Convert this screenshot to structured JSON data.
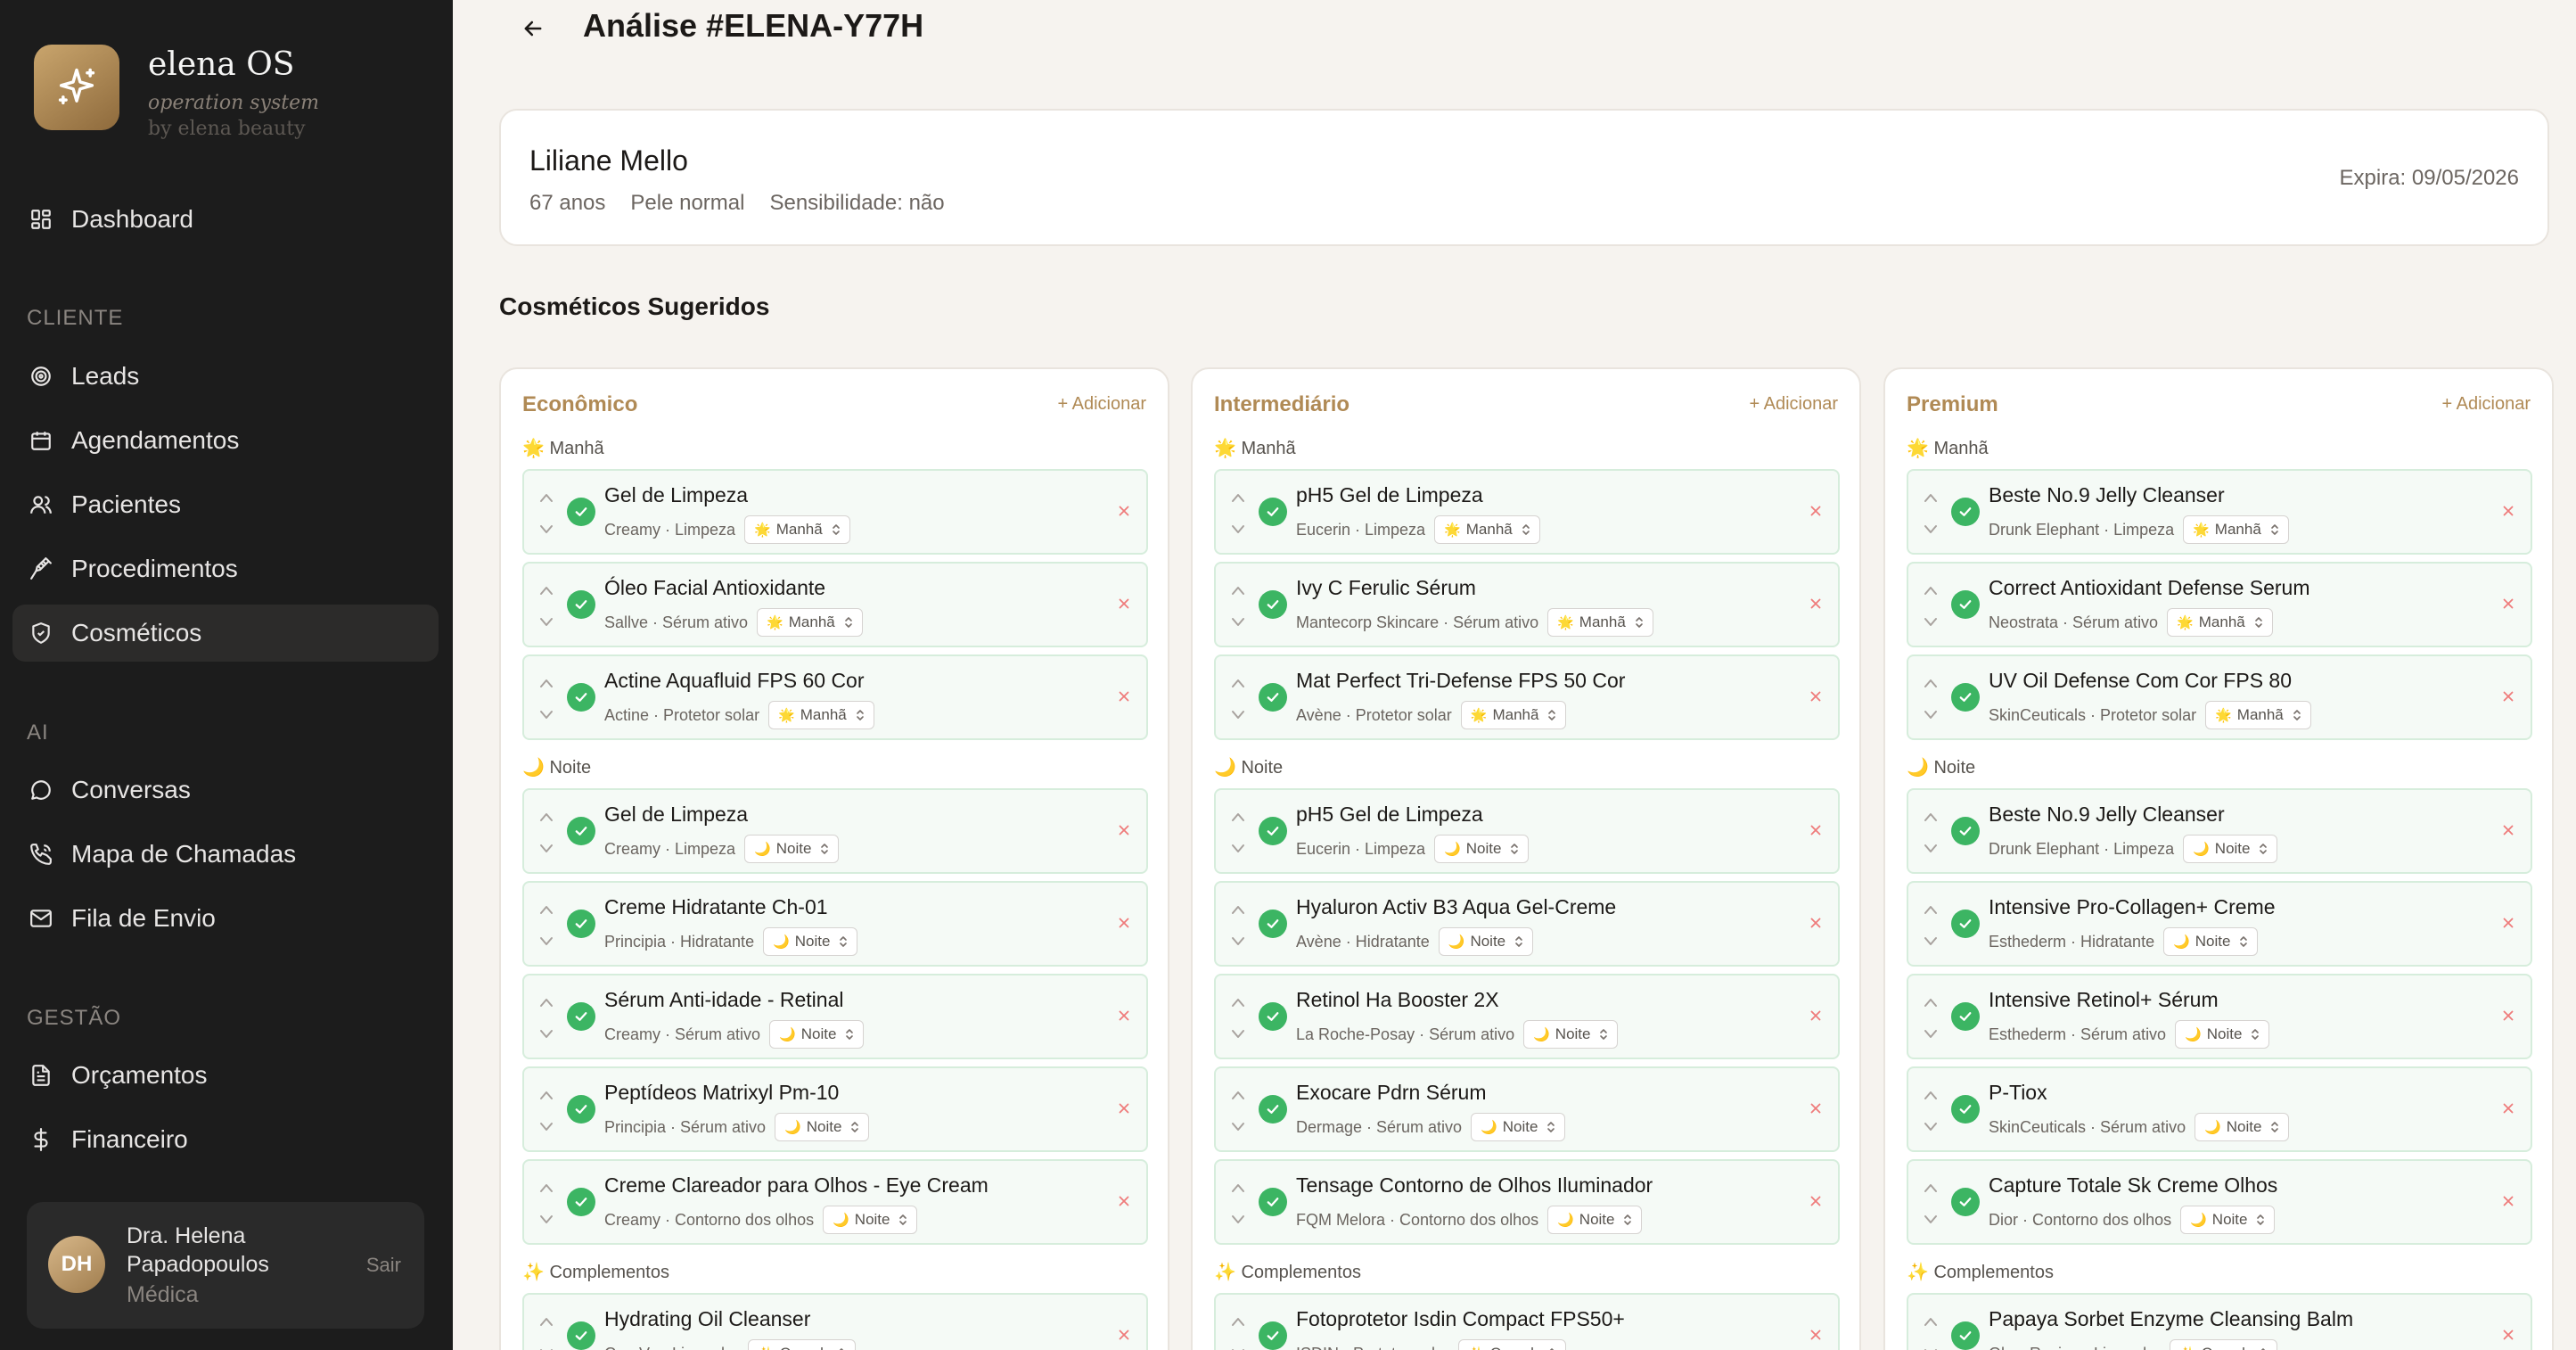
{
  "brand": {
    "name": "elena OS",
    "subtitle": "operation system",
    "byline": "by elena beauty",
    "logo_icon": "sparkles-icon"
  },
  "nav": {
    "dashboard": "Dashboard",
    "sections": {
      "cliente": "CLIENTE",
      "ai": "AI",
      "gestao": "GESTÃO"
    },
    "items": {
      "leads": "Leads",
      "agendamentos": "Agendamentos",
      "pacientes": "Pacientes",
      "procedimentos": "Procedimentos",
      "cosmeticos": "Cosméticos",
      "conversas": "Conversas",
      "mapa": "Mapa de Chamadas",
      "fila": "Fila de Envio",
      "orcamentos": "Orçamentos",
      "financeiro": "Financeiro"
    }
  },
  "user": {
    "initials": "DH",
    "name": "Dra. Helena Papadopoulos",
    "role": "Médica",
    "logout": "Sair"
  },
  "header": {
    "title": "Análise #ELENA-Y77H"
  },
  "client": {
    "name": "Liliane Mello",
    "age": "67 anos",
    "skin": "Pele normal",
    "sensitivity": "Sensibilidade: não",
    "expiry": "Expira: 09/05/2026"
  },
  "section_title": "Cosméticos Sugeridos",
  "colors": {
    "accent": "#b08a55",
    "success": "#3cb563",
    "remove": "#ef7b7b",
    "sidebar": "#1c1c1c"
  },
  "groups": {
    "manha": "🌟 Manhã",
    "noite": "🌙 Noite",
    "complementos": "✨ Complementos"
  },
  "columns": [
    {
      "title": "Econômico",
      "add": "+ Adicionar",
      "items": [
        {
          "name": "Gel de Limpeza",
          "sub": "Creamy · Limpeza",
          "period": "Manhã",
          "emoji": "🌟"
        },
        {
          "name": "Óleo Facial Antioxidante",
          "sub": "Sallve · Sérum ativo",
          "period": "Manhã",
          "emoji": "🌟"
        },
        {
          "name": "Actine Aquafluid FPS 60 Cor",
          "sub": "Actine · Protetor solar",
          "period": "Manhã",
          "emoji": "🌟"
        },
        {
          "name": "Gel de Limpeza",
          "sub": "Creamy · Limpeza",
          "period": "Noite",
          "emoji": "🌙"
        },
        {
          "name": "Creme Hidratante Ch-01",
          "sub": "Principia · Hidratante",
          "period": "Noite",
          "emoji": "🌙"
        },
        {
          "name": "Sérum Anti-idade - Retinal",
          "sub": "Creamy · Sérum ativo",
          "period": "Noite",
          "emoji": "🌙"
        },
        {
          "name": "Peptídeos Matrixyl Pm-10",
          "sub": "Principia · Sérum ativo",
          "period": "Noite",
          "emoji": "🌙"
        },
        {
          "name": "Creme Clareador para Olhos - Eye Cream",
          "sub": "Creamy · Contorno dos olhos",
          "period": "Noite",
          "emoji": "🌙"
        },
        {
          "name": "Hydrating Oil Cleanser",
          "sub": "CeraVe · Limpador",
          "period": "Compl.",
          "emoji": "✨"
        }
      ]
    },
    {
      "title": "Intermediário",
      "add": "+ Adicionar",
      "items": [
        {
          "name": "pH5 Gel de Limpeza",
          "sub": "Eucerin · Limpeza",
          "period": "Manhã",
          "emoji": "🌟"
        },
        {
          "name": "Ivy C Ferulic Sérum",
          "sub": "Mantecorp Skincare · Sérum ativo",
          "period": "Manhã",
          "emoji": "🌟"
        },
        {
          "name": "Mat Perfect Tri-Defense FPS 50 Cor",
          "sub": "Avène · Protetor solar",
          "period": "Manhã",
          "emoji": "🌟"
        },
        {
          "name": "pH5 Gel de Limpeza",
          "sub": "Eucerin · Limpeza",
          "period": "Noite",
          "emoji": "🌙"
        },
        {
          "name": "Hyaluron Activ B3 Aqua Gel-Creme",
          "sub": "Avène · Hidratante",
          "period": "Noite",
          "emoji": "🌙"
        },
        {
          "name": "Retinol Ha Booster 2X",
          "sub": "La Roche-Posay · Sérum ativo",
          "period": "Noite",
          "emoji": "🌙"
        },
        {
          "name": "Exocare Pdrn Sérum",
          "sub": "Dermage · Sérum ativo",
          "period": "Noite",
          "emoji": "🌙"
        },
        {
          "name": "Tensage Contorno de Olhos Iluminador",
          "sub": "FQM Melora · Contorno dos olhos",
          "period": "Noite",
          "emoji": "🌙"
        },
        {
          "name": "Fotoprotetor Isdin Compact FPS50+",
          "sub": "ISDIN · Protetor solar",
          "period": "Compl.",
          "emoji": "✨"
        }
      ]
    },
    {
      "title": "Premium",
      "add": "+ Adicionar",
      "items": [
        {
          "name": "Beste No.9 Jelly Cleanser",
          "sub": "Drunk Elephant · Limpeza",
          "period": "Manhã",
          "emoji": "🌟"
        },
        {
          "name": "Correct Antioxidant Defense Serum",
          "sub": "Neostrata · Sérum ativo",
          "period": "Manhã",
          "emoji": "🌟"
        },
        {
          "name": "UV Oil Defense Com Cor FPS 80",
          "sub": "SkinCeuticals · Protetor solar",
          "period": "Manhã",
          "emoji": "🌟"
        },
        {
          "name": "Beste No.9 Jelly Cleanser",
          "sub": "Drunk Elephant · Limpeza",
          "period": "Noite",
          "emoji": "🌙"
        },
        {
          "name": "Intensive Pro-Collagen+ Creme",
          "sub": "Esthederm · Hidratante",
          "period": "Noite",
          "emoji": "🌙"
        },
        {
          "name": "Intensive Retinol+ Sérum",
          "sub": "Esthederm · Sérum ativo",
          "period": "Noite",
          "emoji": "🌙"
        },
        {
          "name": "P-Tiox",
          "sub": "SkinCeuticals · Sérum ativo",
          "period": "Noite",
          "emoji": "🌙"
        },
        {
          "name": "Capture Totale Sk Creme Olhos",
          "sub": "Dior · Contorno dos olhos",
          "period": "Noite",
          "emoji": "🌙"
        },
        {
          "name": "Papaya Sorbet Enzyme Cleansing Balm",
          "sub": "Glow Recipe · Limpador",
          "period": "Compl.",
          "emoji": "✨"
        }
      ]
    }
  ]
}
